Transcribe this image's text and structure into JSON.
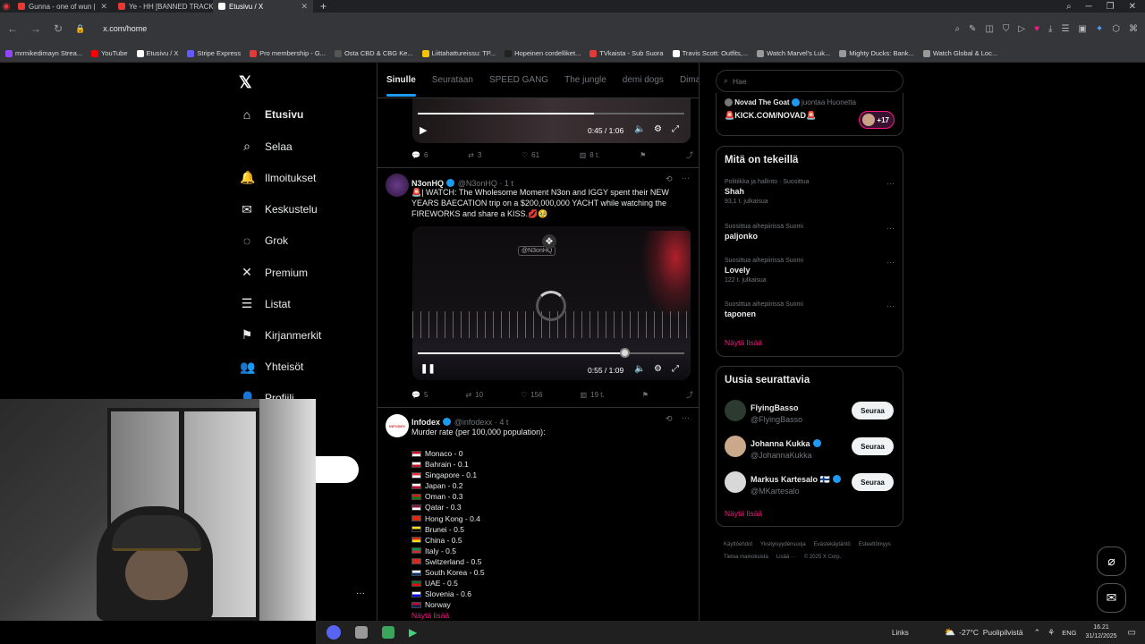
{
  "browser": {
    "tabs": [
      {
        "label": "Gunna - one of wun |",
        "active": false,
        "color": "#e53935"
      },
      {
        "label": "Ye - HH [BANNED TRACK",
        "active": false,
        "color": "#e53935"
      },
      {
        "label": "Etusivu / X",
        "active": true,
        "color": "#ffffff"
      }
    ],
    "new_tab": "+",
    "url": "x.com/home",
    "bookmarks": [
      {
        "label": "mrmikedimayn Strea...",
        "color": "#9146ff"
      },
      {
        "label": "YouTube",
        "color": "#ff0000"
      },
      {
        "label": "Etusivu / X",
        "color": "#ffffff"
      },
      {
        "label": "Stripe Express",
        "color": "#635bff"
      },
      {
        "label": "Pro membership - G...",
        "color": "#e53935"
      },
      {
        "label": "Osta CBD & CBG Ke...",
        "color": "#555555"
      },
      {
        "label": "Liittahattureissu: TP...",
        "color": "#f4c20d"
      },
      {
        "label": "Hopeinen cordelliket...",
        "color": "#222222"
      },
      {
        "label": "TVkaista - Sub Suora",
        "color": "#e53935"
      },
      {
        "label": "Travis Scott: Outfits,...",
        "color": "#ffffff"
      },
      {
        "label": "Watch Marvel's Luk...",
        "color": "#999999"
      },
      {
        "label": "Mighty Ducks: Bank...",
        "color": "#999999"
      },
      {
        "label": "Watch Global & Loc...",
        "color": "#999999"
      }
    ]
  },
  "nav": {
    "items": [
      {
        "label": "Etusivu",
        "icon": "home-icon",
        "glyph": "⌂"
      },
      {
        "label": "Selaa",
        "icon": "search-icon",
        "glyph": "⌕"
      },
      {
        "label": "Ilmoitukset",
        "icon": "bell-icon",
        "glyph": "🔔"
      },
      {
        "label": "Keskustelu",
        "icon": "mail-icon",
        "glyph": "✉"
      },
      {
        "label": "Grok",
        "icon": "grok-icon",
        "glyph": "◌"
      },
      {
        "label": "Premium",
        "icon": "x-premium-icon",
        "glyph": "✕"
      },
      {
        "label": "Listat",
        "icon": "list-icon",
        "glyph": "☰"
      },
      {
        "label": "Kirjanmerkit",
        "icon": "bookmark-icon",
        "glyph": "⚑"
      },
      {
        "label": "Yhteisöt",
        "icon": "communities-icon",
        "glyph": "👥"
      },
      {
        "label": "Profiili",
        "icon": "profile-icon",
        "glyph": "👤"
      }
    ]
  },
  "timeline": {
    "tabs": [
      "Sinulle",
      "Seurataan",
      "SPEED GANG",
      "The jungle",
      "demi dogs",
      "Dima's Dl"
    ],
    "post1": {
      "time": "0:45 / 1:06",
      "progress": 0.66,
      "replies": "6",
      "reposts": "3",
      "likes": "61",
      "views": "8 t."
    },
    "post2": {
      "name": "N3onHQ",
      "handle": "@N3onHQ · 1 t",
      "text": "🚨| WATCH: The Wholesome Moment N3on and IGGY spent their NEW YEARS BAECATION trip on a $200,000,000 YACHT while watching the FIREWORKS and share a KISS.💋🥹",
      "watermark": "@N3onHQ",
      "time": "0:55 / 1:09",
      "progress": 0.78,
      "replies": "5",
      "reposts": "10",
      "likes": "156",
      "views": "19 t."
    },
    "post3": {
      "name": "Infodex",
      "handle": "@infodexx · 4 t",
      "avatar_text": "INFODEX",
      "text": "Murder rate (per 100,000 population):",
      "list": [
        {
          "label": "Monaco - 0",
          "flag": [
            "#ce1126",
            "#ffffff"
          ]
        },
        {
          "label": "Bahrain - 0.1",
          "flag": [
            "#ffffff",
            "#ce1126"
          ]
        },
        {
          "label": "Singapore - 0.1",
          "flag": [
            "#ef3340",
            "#ffffff"
          ]
        },
        {
          "label": "Japan - 0.2",
          "flag": [
            "#ffffff",
            "#bc002d"
          ]
        },
        {
          "label": "Oman - 0.3",
          "flag": [
            "#db161b",
            "#008000"
          ]
        },
        {
          "label": "Qatar - 0.3",
          "flag": [
            "#8a1538",
            "#ffffff"
          ]
        },
        {
          "label": "Hong Kong - 0.4",
          "flag": [
            "#de2910",
            "#de2910"
          ]
        },
        {
          "label": "Brunei - 0.5",
          "flag": [
            "#f7e017",
            "#000000"
          ]
        },
        {
          "label": "China - 0.5",
          "flag": [
            "#de2910",
            "#ffde00"
          ]
        },
        {
          "label": "Italy - 0.5",
          "flag": [
            "#009246",
            "#ce2b37"
          ]
        },
        {
          "label": "Switzerland - 0.5",
          "flag": [
            "#da291c",
            "#da291c"
          ]
        },
        {
          "label": "South Korea - 0.5",
          "flag": [
            "#ffffff",
            "#003478"
          ]
        },
        {
          "label": "UAE - 0.5",
          "flag": [
            "#00732f",
            "#ff0000"
          ]
        },
        {
          "label": "Slovenia - 0.6",
          "flag": [
            "#ffffff",
            "#0000ff"
          ]
        },
        {
          "label": "Norway",
          "flag": [
            "#ba0c2f",
            "#00205b"
          ]
        }
      ],
      "show_more": "Näytä lisää"
    }
  },
  "sidebar": {
    "search_placeholder": "Hae",
    "live": {
      "name": "Novad The Goat",
      "status": "juontaa Huonetta",
      "title": "🚨KICK.COM/NOVAD🚨",
      "count": "+17"
    },
    "trends_title": "Mitä on tekeillä",
    "trends": [
      {
        "meta": "Politiikka ja hallinto · Suosittua",
        "name": "Shah",
        "count": "93,1 t. julkaisua"
      },
      {
        "meta": "Suosittua aihepiirissä Suomi",
        "name": "paljonko",
        "count": ""
      },
      {
        "meta": "Suosittua aihepiirissä Suomi",
        "name": "Lovely",
        "count": "122 t. julkaisua"
      },
      {
        "meta": "Suosittua aihepiirissä Suomi",
        "name": "taponen",
        "count": ""
      }
    ],
    "trends_more": "Näytä lisää",
    "who_title": "Uusia seurattavia",
    "who": [
      {
        "name": "FlyingBasso",
        "handle": "@FlyingBasso",
        "verified": false,
        "button": "Seuraa"
      },
      {
        "name": "Johanna Kukka",
        "handle": "@JohannaKukka",
        "verified": true,
        "button": "Seuraa"
      },
      {
        "name": "Markus Kartesalo 🇫🇮",
        "handle": "@MKartesalo",
        "verified": true,
        "button": "Seuraa"
      }
    ],
    "who_more": "Näytä lisää",
    "footer": [
      "Käyttöehdot",
      "Yksityisyydensuoja",
      "Evästekäytäntö",
      "Esteettömyys",
      "Tietoa mainoksista",
      "Lisää ···",
      "© 2025 X Corp."
    ]
  },
  "taskbar": {
    "links": "Links",
    "weather": "-27°C  Puolipilvistä",
    "lang": "ENG",
    "time": "16.21",
    "date": "31/12/2025"
  }
}
